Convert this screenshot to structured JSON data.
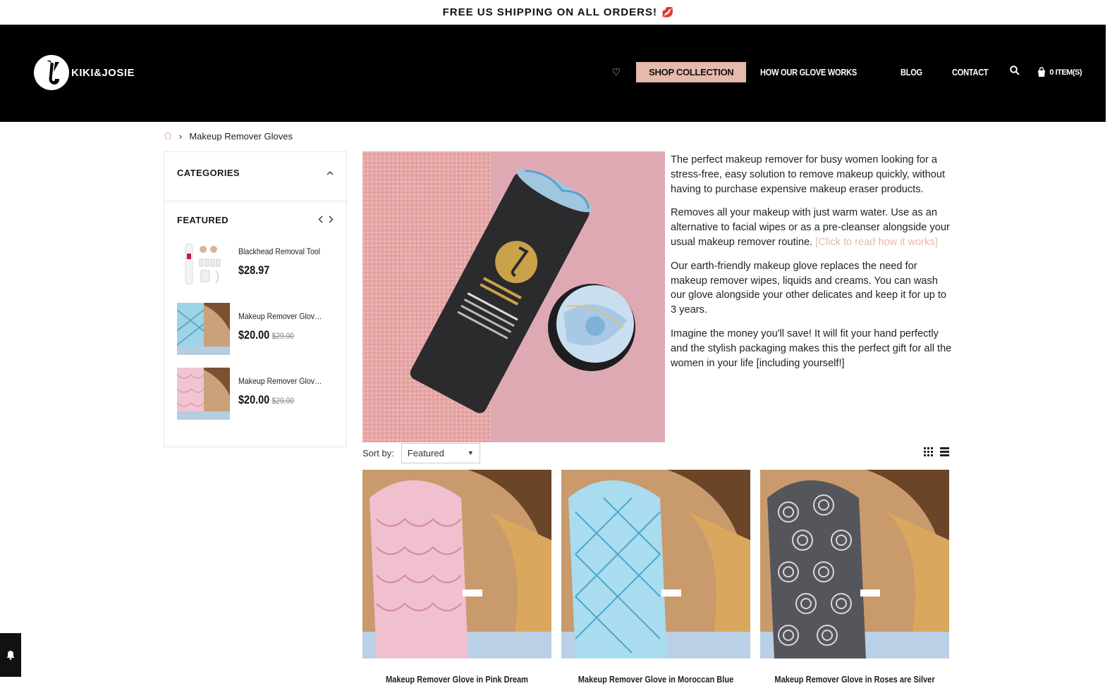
{
  "topbar": {
    "text": "FREE US SHIPPING ON ALL ORDERS!",
    "emoji": "💋"
  },
  "header": {
    "logo_text": "KIKI&JOSIE",
    "nav": [
      "SHOP COLLECTION",
      "HOW OUR GLOVE WORKS",
      "BLOG",
      "CONTACT"
    ],
    "cart_label": "0 ITEM(S)"
  },
  "breadcrumb": {
    "current": "Makeup Remover Gloves"
  },
  "sidebar": {
    "categories_title": "CATEGORIES",
    "featured_title": "FEATURED",
    "featured_items": [
      {
        "name": "Blackhead Removal Tool",
        "price": "$28.97",
        "compare": ""
      },
      {
        "name": "Makeup Remover Glove in Moroccan Blue",
        "price": "$20.00",
        "compare": "$29.00"
      },
      {
        "name": "Makeup Remover Glove in Pink Dream",
        "price": "$20.00",
        "compare": "$29.00"
      }
    ]
  },
  "description": {
    "p1": "The perfect makeup remover for busy women looking for a  stress-free, easy solution to remove makeup quickly, without having to purchase expensive makeup eraser products.",
    "p2": "Removes all your makeup with just warm water. Use as an alternative to facial  wipes or as a pre-cleanser alongside your usual makeup remover routine. ",
    "p2_link": "[Click to read how it works]",
    "p3": "Our earth-friendly makeup glove replaces the need for makeup remover wipes, liquids and creams. You can wash our glove alongside your other delicates and keep it for up to 3 years.",
    "p4": "Imagine the money you'll save! It will fit your hand perfectly and the stylish packaging makes this the perfect gift for all the women in your life [including yourself!]"
  },
  "sort": {
    "label": "Sort by:",
    "selected": "Featured"
  },
  "products": [
    {
      "name": "Makeup Remover Glove in Pink Dream"
    },
    {
      "name": "Makeup Remover Glove in Moroccan Blue"
    },
    {
      "name": "Makeup Remover Glove in Roses are Silver"
    }
  ],
  "colors": {
    "accent": "#e6b9ac",
    "header_bg": "#000000"
  },
  "icons": [
    "heart-icon",
    "search-icon",
    "cart-icon",
    "home-icon",
    "chevron-up-icon",
    "grid-view-icon",
    "list-view-icon",
    "bell-icon"
  ]
}
